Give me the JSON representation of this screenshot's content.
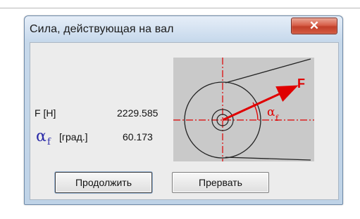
{
  "window": {
    "title": "Сила, действующая на вал",
    "close_glyph": "✕"
  },
  "fields": {
    "force_label": "F  [Н]",
    "force_value": "2229.585",
    "angle_symbol": "α",
    "angle_subscript": "f",
    "angle_unit": "[град.]",
    "angle_value": "60.173"
  },
  "diagram": {
    "force_label": "F",
    "angle_symbol": "α",
    "angle_subscript": "f",
    "colors": {
      "lines": "#222222",
      "arrow": "#e00000",
      "axis": "#e00000",
      "background": "#c9c9c9"
    }
  },
  "buttons": {
    "continue_label": "Продолжить",
    "abort_label": "Прервать"
  }
}
